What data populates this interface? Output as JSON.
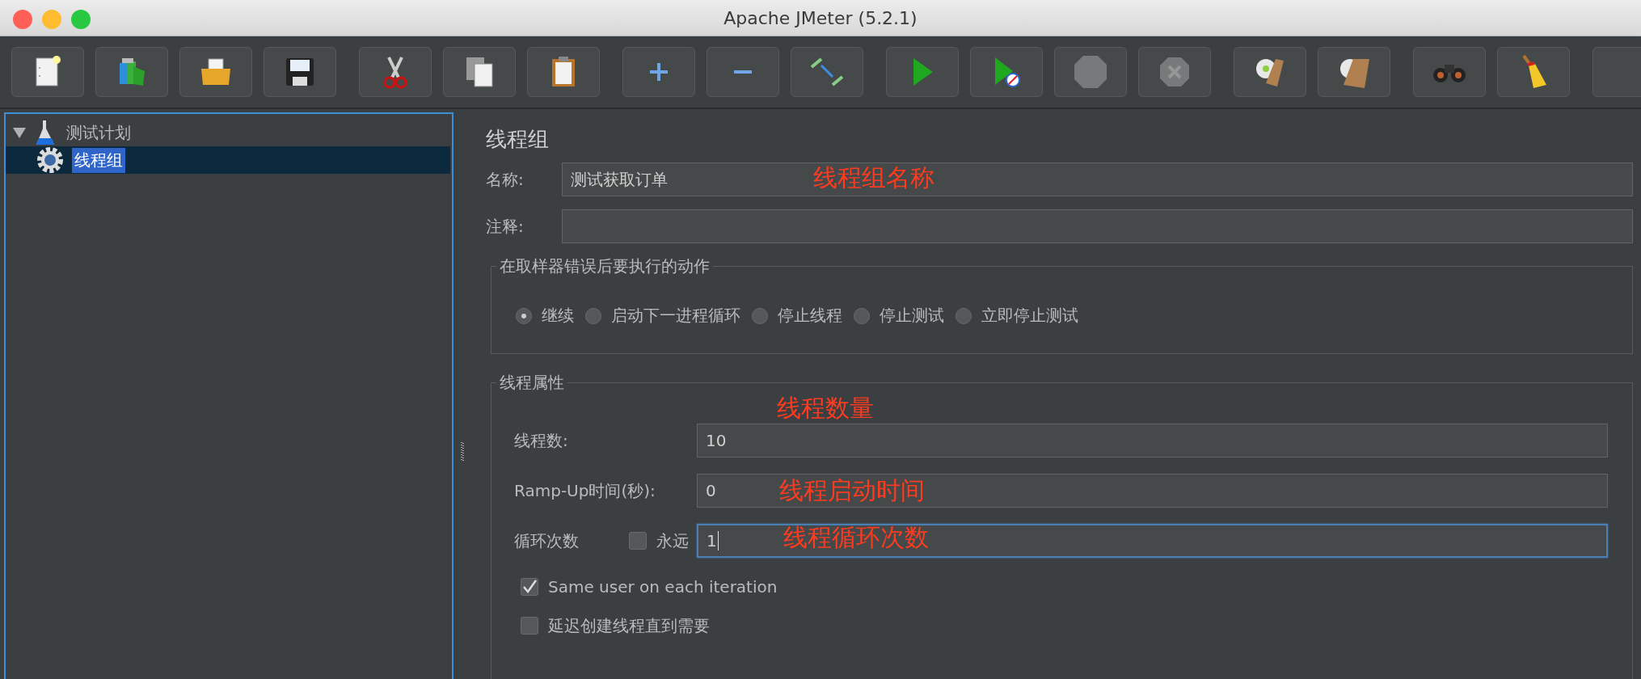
{
  "window": {
    "title": "Apache JMeter (5.2.1)"
  },
  "toolbar": [
    [
      {
        "kind": "new",
        "disabled": false
      },
      {
        "kind": "templates",
        "disabled": false
      },
      {
        "kind": "open",
        "disabled": false
      },
      {
        "kind": "save",
        "disabled": false
      }
    ],
    [
      {
        "kind": "cut",
        "disabled": false
      },
      {
        "kind": "copy",
        "disabled": false
      },
      {
        "kind": "paste",
        "disabled": false
      }
    ],
    [
      {
        "kind": "expand",
        "disabled": false
      },
      {
        "kind": "collapse",
        "disabled": false
      },
      {
        "kind": "toggle",
        "disabled": false
      }
    ],
    [
      {
        "kind": "start",
        "disabled": false
      },
      {
        "kind": "startnopause",
        "disabled": false
      },
      {
        "kind": "stop",
        "disabled": true
      },
      {
        "kind": "shutdown",
        "disabled": true
      }
    ],
    [
      {
        "kind": "clear",
        "disabled": false
      },
      {
        "kind": "clearall",
        "disabled": false
      }
    ],
    [
      {
        "kind": "search",
        "disabled": false
      },
      {
        "kind": "reset",
        "disabled": false
      }
    ]
  ],
  "tree": [
    {
      "label": "测试计划",
      "kind": "plan",
      "expanded": true,
      "selected": false,
      "children": [
        {
          "label": "线程组",
          "kind": "threadgroup",
          "selected": true
        }
      ]
    }
  ],
  "panel": {
    "title": "线程组",
    "name": {
      "label": "名称:",
      "value": "测试获取订单",
      "annotation": "线程组名称"
    },
    "comment": {
      "label": "注释:"
    },
    "error_action": {
      "legend": "在取样器错误后要执行的动作",
      "options": [
        {
          "label": "继续",
          "selected": true
        },
        {
          "label": "启动下一进程循环",
          "selected": false
        },
        {
          "label": "停止线程",
          "selected": false
        },
        {
          "label": "停止测试",
          "selected": false
        },
        {
          "label": "立即停止测试",
          "selected": false
        }
      ]
    },
    "thread_properties": {
      "legend": "线程属性",
      "threads": {
        "label": "线程数:",
        "value": "10",
        "annotation": "线程数量"
      },
      "ramp_up": {
        "label": "Ramp-Up时间(秒):",
        "value": "0",
        "annotation": "线程启动时间"
      },
      "loop": {
        "label": "循环次数",
        "forever": {
          "label": "永远",
          "checked": false
        },
        "value": "1",
        "focused": true,
        "annotation": "线程循环次数"
      },
      "options": [
        {
          "label": "Same user on each iteration",
          "checked": true
        },
        {
          "label": "延迟创建线程直到需要",
          "checked": false
        }
      ]
    }
  }
}
